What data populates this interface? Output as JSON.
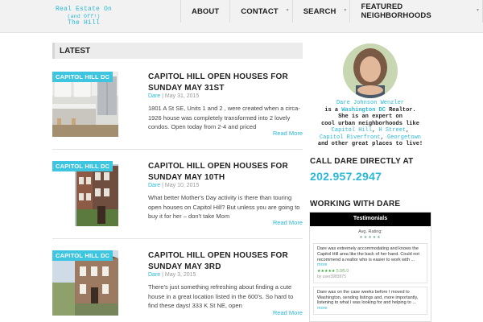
{
  "logo": {
    "line1": "Real Estate On",
    "line2": "(and Off!)",
    "line3": "The Hill"
  },
  "nav": [
    {
      "label": "ABOUT",
      "caret": false
    },
    {
      "label": "CONTACT",
      "caret": true
    },
    {
      "label": "SEARCH",
      "caret": true
    },
    {
      "label": "FEATURED NEIGHBORHOODS",
      "caret": true
    }
  ],
  "latest": {
    "label": "LATEST"
  },
  "posts": [
    {
      "category": "CAPITOL HILL DC",
      "title": "CAPITOL HILL OPEN HOUSES FOR SUNDAY MAY 31ST",
      "author": "Dare",
      "separator": "|",
      "date": "May 31, 2015",
      "excerpt": "1801 A St SE, Units 1 and 2 , were created when a circa-1926 house was completely transformed into 2 lovely condos. Open today from 2-4 and priced",
      "read_more": "Read More"
    },
    {
      "category": "CAPITOL HILL DC",
      "title": "CAPITOL HILL OPEN HOUSES FOR SUNDAY MAY 10TH",
      "author": "Dare",
      "separator": "|",
      "date": "May 10, 2015",
      "excerpt": "What better Mother's Day activity is there than touring open houses on Capitol Hill? But unless you are going to buy it for her – don't take Mom",
      "read_more": "Read More"
    },
    {
      "category": "CAPITOL HILL DC",
      "title": "CAPITOL HILL OPEN HOUSES FOR SUNDAY MAY 3RD",
      "author": "Dare",
      "separator": "|",
      "date": "May 3, 2015",
      "excerpt": "There's just something refreshing about finding a cute house in a great location listed in the 600's.  So hard to find these days! 333 K St NE, open",
      "read_more": "Read More"
    }
  ],
  "sidebar": {
    "bio": {
      "name": "Dare Johnson Wenzler",
      "is_a": "is a",
      "dc": "Washington DC",
      "realtor": "Realtor.",
      "expert": "She is an expert on",
      "cool": "cool urban neighborhoods like",
      "n1": "Capitol Hill",
      "comma1": ",",
      "n2": "H Street",
      "comma2": ",",
      "n3": "Capitol Riverfront",
      "comma3": ",",
      "n4": "Georgetown",
      "end": "and other great places to live!"
    },
    "call_title": "CALL DARE DIRECTLY AT",
    "phone": "202.957.2947",
    "working_title": "WORKING WITH DARE",
    "testimonials": {
      "header": "Testimonials",
      "avg_label": "Avg. Rating:",
      "avg_stars": "★★★★★",
      "items": [
        {
          "text": "Dare was extremely accommodating and knows the Capitol Hill area like the back of her hand. Could not recommend a realtor who is easier to work with ...",
          "more": "more",
          "stars": "★★★★★",
          "score": "5.0/5.0",
          "by": "by user3983975"
        },
        {
          "text": "Dare was on the case weeks before I moved to Washington, sending listings and, more importantly, listening to what I was looking for and helping to ...",
          "more": "more"
        }
      ]
    }
  },
  "colors": {
    "accent": "#2ab8d6",
    "label_bg": "#3ec5e0",
    "heading": "#222222",
    "header_bg": "#f2f2f2"
  }
}
